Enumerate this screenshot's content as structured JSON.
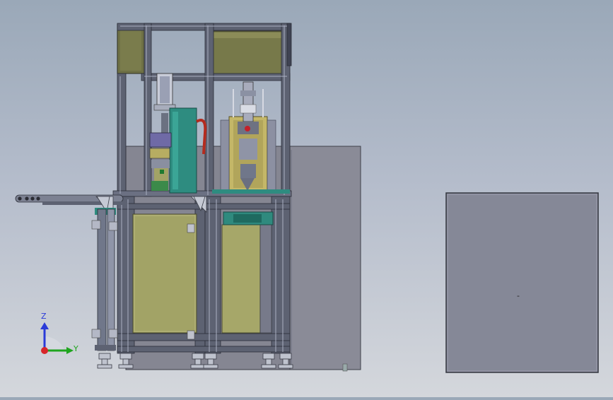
{
  "viewport": {
    "background_top": "#9aa8b8",
    "background_bottom": "#d4d7dc"
  },
  "triad": {
    "z_label": "Z",
    "y_label": "Y",
    "z_color": "#2a3ad8",
    "y_color": "#1fa51f",
    "x_color": "#d8262a"
  },
  "panel_marker": "-",
  "colors": {
    "frame": "#5b6070",
    "frame_light": "#8b90a2",
    "panel_olive": "#a0a065",
    "panel_olive_dark": "#6f7148",
    "cabinet": "#848592",
    "teal": "#2e8c80",
    "brass": "#c8ba6a",
    "enclosure": "#868a9a"
  }
}
